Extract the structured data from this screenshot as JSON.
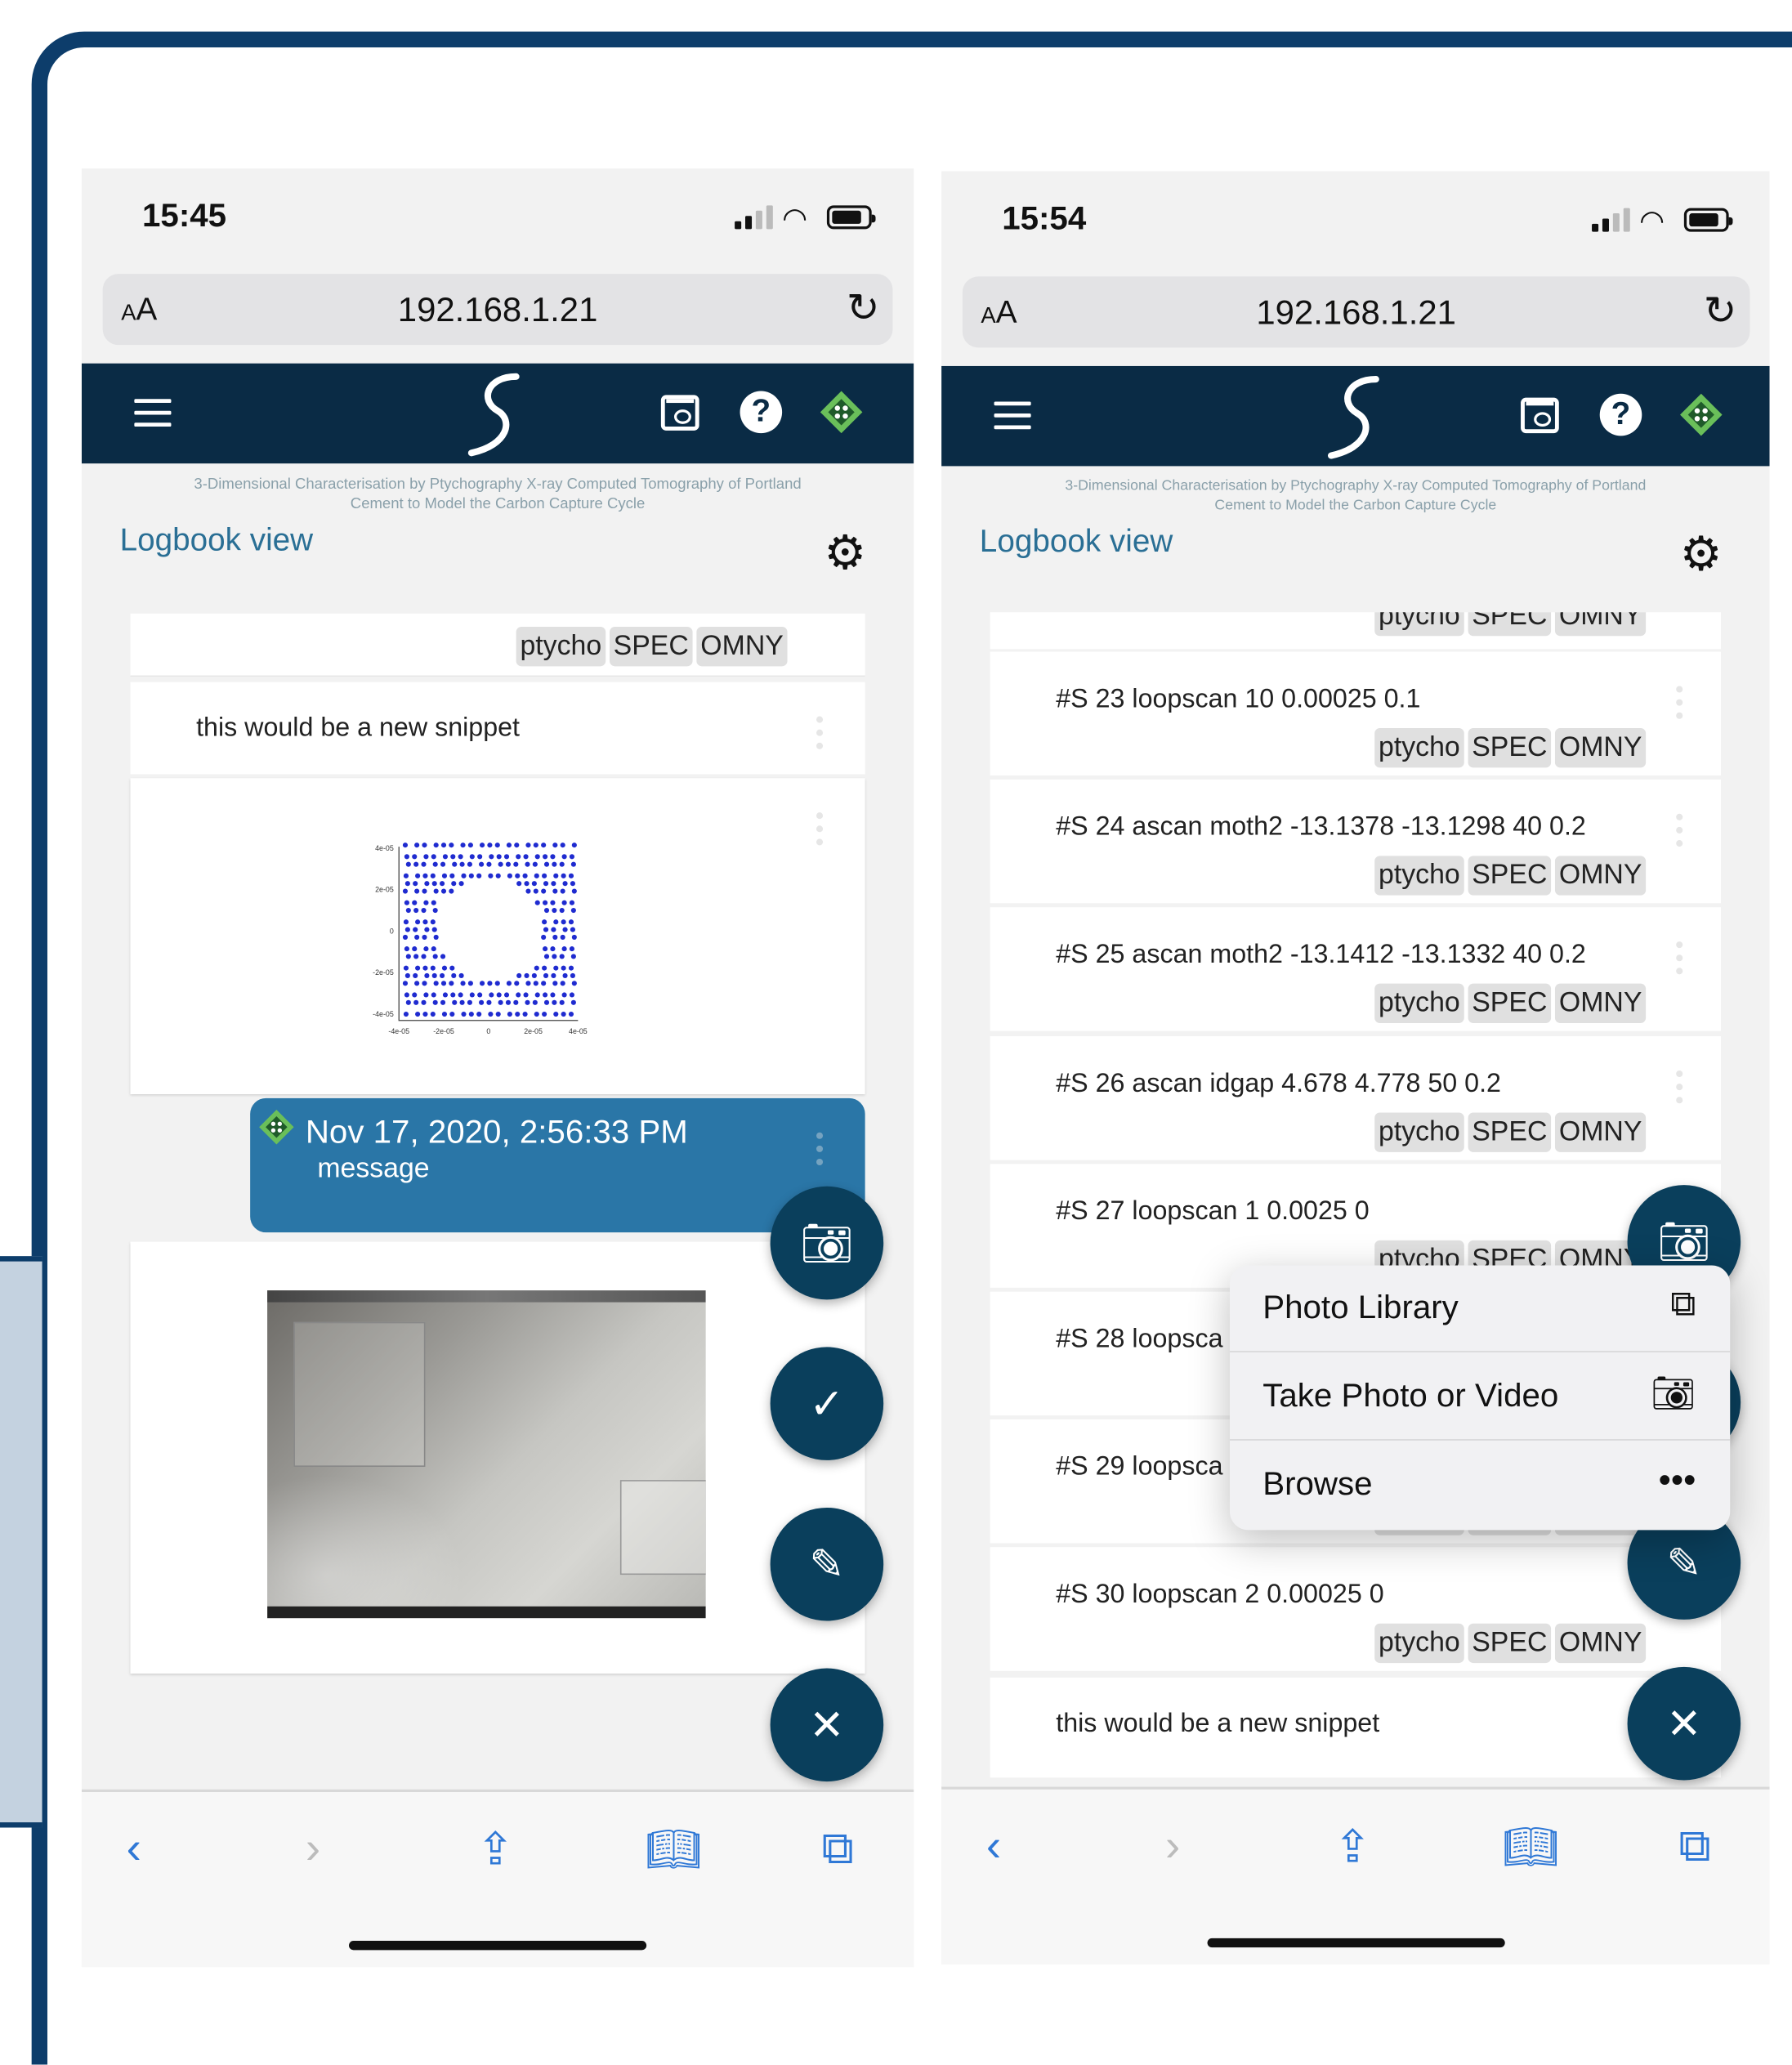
{
  "left": {
    "time": "15:45",
    "url": "192.168.1.21",
    "aa_label": "AA",
    "subtitle": "3-Dimensional Characterisation by Ptychography X-ray Computed Tomography of Portland Cement to Model the Carbon Capture Cycle",
    "view_title": "Logbook view",
    "tags": [
      "ptycho",
      "SPEC",
      "OMNY"
    ],
    "snippet_text": "this would be a new snippet",
    "message_date": "Nov 17, 2020, 2:56:33 PM",
    "message_text": "message",
    "plot_ticks_y": [
      "4e-05",
      "2e-05",
      "0",
      "-2e-05",
      "-4e-05"
    ],
    "plot_ticks_x": [
      "-4e-05",
      "-2e-05",
      "0",
      "2e-05",
      "4e-05"
    ]
  },
  "right": {
    "time": "15:54",
    "url": "192.168.1.21",
    "aa_label": "AA",
    "subtitle": "3-Dimensional Characterisation by Ptychography X-ray Computed Tomography of Portland Cement to Model the Carbon Capture Cycle",
    "view_title": "Logbook view",
    "tags": [
      "ptycho",
      "SPEC",
      "OMNY"
    ],
    "entries": [
      "#S 23 loopscan 10 0.00025 0.1",
      "#S 24 ascan moth2 -13.1378 -13.1298 40 0.2",
      "#S 25 ascan moth2 -13.1412 -13.1332 40 0.2",
      "#S 26 ascan idgap 4.678 4.778 50 0.2",
      "#S 27 loopscan 1 0.0025 0",
      "#S 28 loopsca",
      "#S 29 loopsca",
      "#S 30 loopscan 2 0.00025 0"
    ],
    "snippet_text": "this would be a new snippet",
    "popup": [
      {
        "label": "Photo Library",
        "icon": "photo-library-icon"
      },
      {
        "label": "Take Photo or Video",
        "icon": "camera-icon"
      },
      {
        "label": "Browse",
        "icon": "more-icon"
      }
    ]
  },
  "colors": {
    "navbar": "#0a2b45",
    "fab": "#0a3f5c",
    "message": "#2a76a7",
    "accent_link": "#2a6f95",
    "ios_blue": "#2f78d6",
    "frame": "#0d3d6b"
  }
}
